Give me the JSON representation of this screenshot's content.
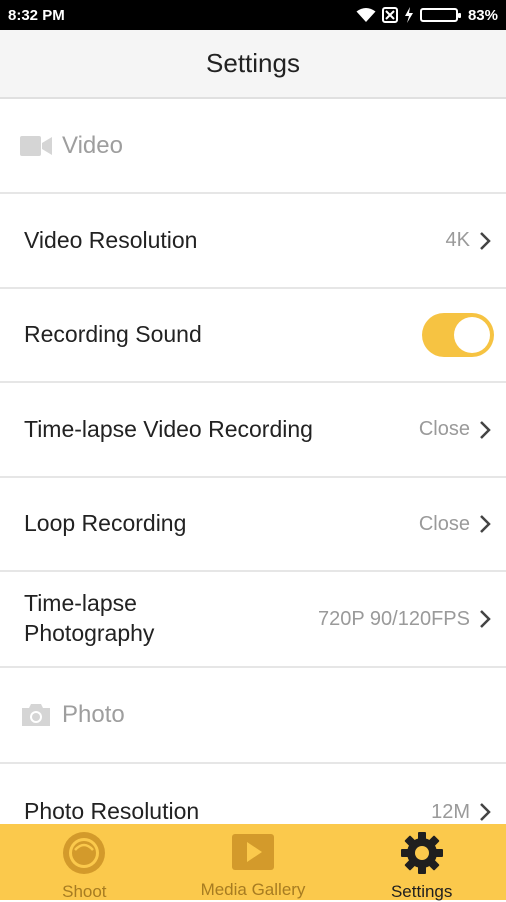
{
  "status_bar": {
    "time": "8:32 PM",
    "battery_percent": "83%"
  },
  "header": {
    "title": "Settings"
  },
  "sections": {
    "video": {
      "label": "Video",
      "icon": "video-camera-icon"
    },
    "photo": {
      "label": "Photo",
      "icon": "camera-icon"
    }
  },
  "rows": {
    "video_resolution": {
      "label": "Video Resolution",
      "value": "4K"
    },
    "recording_sound": {
      "label": "Recording Sound",
      "enabled": true
    },
    "timelapse_video": {
      "label": "Time-lapse Video Recording",
      "value": "Close"
    },
    "loop_recording": {
      "label": "Loop Recording",
      "value": "Close"
    },
    "timelapse_photo": {
      "label_line1": "Time-lapse",
      "label_line2": "Photography",
      "value": "720P 90/120FPS"
    },
    "photo_resolution": {
      "label": "Photo Resolution",
      "value": "12M"
    }
  },
  "bottom_nav": {
    "items": [
      {
        "label": "Shoot",
        "icon": "lens-icon",
        "active": false
      },
      {
        "label": "Media Gallery",
        "icon": "play-icon",
        "active": false
      },
      {
        "label": "Settings",
        "icon": "gear-icon",
        "active": true
      }
    ]
  },
  "colors": {
    "accent": "#fbc94c",
    "toggle_on": "#f6c342",
    "active_nav": "#1f1f1f",
    "inactive_nav": "#a77c21"
  }
}
